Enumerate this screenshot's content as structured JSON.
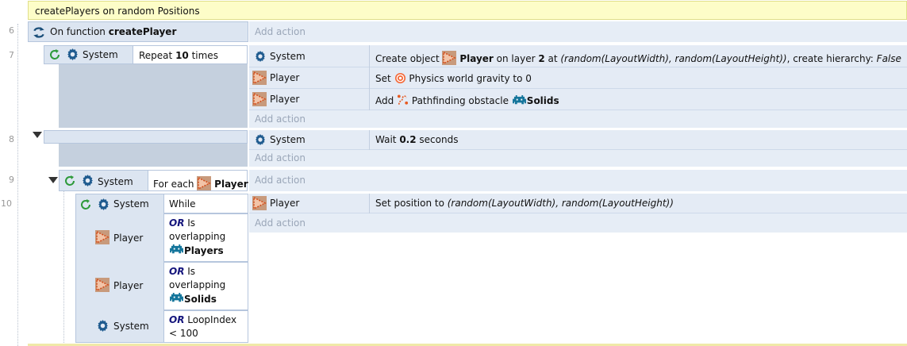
{
  "comment": "createPlayers on random Positions",
  "add_action": "Add action",
  "rows": {
    "r6": {
      "num": "6",
      "prefix": "On function ",
      "fname": "createPlayer"
    },
    "r7": {
      "num": "7",
      "obj": "System",
      "cond_pre": "Repeat ",
      "cond_val": "10",
      "cond_post": " times",
      "actions": [
        {
          "obj": "System",
          "p1": "Create object ",
          "b1": "Player",
          "p2": " on layer ",
          "b2": "2",
          "p3": " at ",
          "i1": "(random(LayoutWidth), random(LayoutHeight))",
          "p4": ", create hierarchy: ",
          "i2": "False"
        },
        {
          "obj": "Player",
          "p1": "Set ",
          "p2": "Physics world gravity to 0"
        },
        {
          "obj": "Player",
          "p1": "Add ",
          "p2": "Pathfinding obstacle ",
          "b1": "Solids"
        }
      ]
    },
    "r8": {
      "num": "8",
      "actions": [
        {
          "obj": "System",
          "p1": "Wait ",
          "b1": "0.2",
          "p2": " seconds"
        }
      ]
    },
    "r9": {
      "num": "9",
      "obj": "System",
      "cond_pre": "For each ",
      "cond_obj": "Player"
    },
    "r10": {
      "num": "10",
      "conds": [
        {
          "obj": "System",
          "t1": "While"
        },
        {
          "obj": "Player",
          "or": "OR",
          "t1": " Is",
          "t2": "overlapping",
          "b1": "Players"
        },
        {
          "obj": "Player",
          "or": "OR",
          "t1": " Is",
          "t2": "overlapping",
          "b1": "Solids"
        },
        {
          "obj": "System",
          "or": "OR",
          "t1": " LoopIndex",
          "t2": "< 100"
        }
      ],
      "actions": [
        {
          "obj": "Player",
          "p1": "Set position to ",
          "i1": "(random(LayoutWidth), random(LayoutHeight))"
        }
      ]
    }
  }
}
